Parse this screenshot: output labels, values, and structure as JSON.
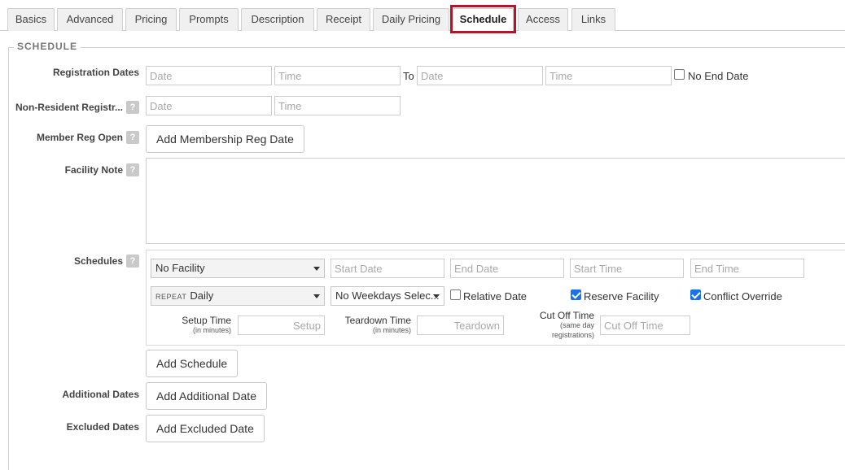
{
  "tabs": [
    {
      "label": "Basics"
    },
    {
      "label": "Advanced"
    },
    {
      "label": "Pricing"
    },
    {
      "label": "Prompts"
    },
    {
      "label": "Description"
    },
    {
      "label": "Receipt"
    },
    {
      "label": "Daily Pricing"
    },
    {
      "label": "Schedule",
      "active": true
    },
    {
      "label": "Access"
    },
    {
      "label": "Links"
    }
  ],
  "section": {
    "legend": "SCHEDULE"
  },
  "registration": {
    "label": "Registration Dates",
    "start_date_placeholder": "Date",
    "start_time_placeholder": "Time",
    "to_label": "To",
    "end_date_placeholder": "Date",
    "end_time_placeholder": "Time",
    "no_end_date_label": "No End Date"
  },
  "non_resident": {
    "label": "Non-Resident Registr...",
    "help": "?",
    "date_placeholder": "Date",
    "time_placeholder": "Time"
  },
  "member_reg": {
    "label": "Member Reg Open",
    "help": "?",
    "button": "Add Membership Reg Date"
  },
  "facility_note": {
    "label": "Facility Note",
    "help": "?"
  },
  "schedules": {
    "label": "Schedules",
    "help": "?",
    "facility_select": "No Facility",
    "start_date_placeholder": "Start Date",
    "end_date_placeholder": "End Date",
    "start_time_placeholder": "Start Time",
    "end_time_placeholder": "End Time",
    "repeat_prefix": "REPEAT",
    "repeat_value": "Daily",
    "weekdays_select": "No Weekdays Selec...",
    "relative_date_label": "Relative Date",
    "relative_date_checked": false,
    "reserve_facility_label": "Reserve Facility",
    "reserve_facility_checked": true,
    "conflict_override_label": "Conflict Override",
    "conflict_override_checked": true,
    "setup_label": "Setup Time",
    "setup_sub": "(in minutes)",
    "setup_placeholder": "Setup",
    "teardown_label": "Teardown Time",
    "teardown_sub": "(in minutes)",
    "teardown_placeholder": "Teardown",
    "cutoff_label": "Cut Off Time",
    "cutoff_sub1": "(same day",
    "cutoff_sub2": "registrations)",
    "cutoff_placeholder": "Cut Off Time",
    "add_button": "Add Schedule"
  },
  "additional_dates": {
    "label": "Additional Dates",
    "button": "Add Additional Date"
  },
  "excluded_dates": {
    "label": "Excluded Dates",
    "button": "Add Excluded Date"
  },
  "colors": {
    "highlight": "#b8132c",
    "checkbox": "#1a73e8"
  },
  "icons": {
    "help": "question-mark-icon",
    "dropdown": "chevron-down-icon"
  }
}
